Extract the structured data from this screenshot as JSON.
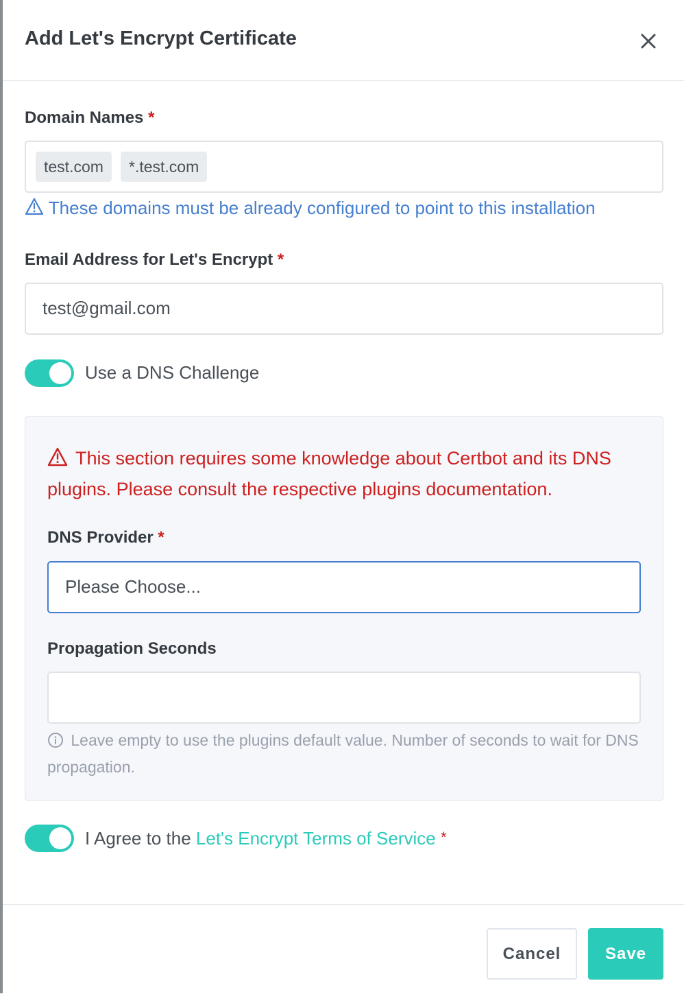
{
  "modal": {
    "title": "Add Let's Encrypt Certificate"
  },
  "domain_names": {
    "label": "Domain Names",
    "required_mark": "*",
    "chips": [
      "test.com",
      "*.test.com"
    ],
    "hint": "These domains must be already configured to point to this installation"
  },
  "email": {
    "label": "Email Address for Let's Encrypt",
    "required_mark": "*",
    "value": "test@gmail.com"
  },
  "dns_challenge": {
    "label": "Use a DNS Challenge",
    "enabled": true
  },
  "dns_panel": {
    "warning": "This section requires some knowledge about Certbot and its DNS plugins. Please consult the respective plugins documentation.",
    "provider": {
      "label": "DNS Provider",
      "required_mark": "*",
      "selected": "Please Choose..."
    },
    "propagation": {
      "label": "Propagation Seconds",
      "value": "",
      "hint": "Leave empty to use the plugins default value. Number of seconds to wait for DNS propagation."
    }
  },
  "agree": {
    "prefix": "I Agree to the",
    "link_text": "Let's Encrypt Terms of Service",
    "required_mark": "*",
    "enabled": true
  },
  "footer": {
    "cancel_label": "Cancel",
    "save_label": "Save"
  },
  "colors": {
    "accent": "#2bcbba",
    "danger": "#cd201f",
    "info": "#467fcf",
    "focus_border": "#467fcf"
  }
}
